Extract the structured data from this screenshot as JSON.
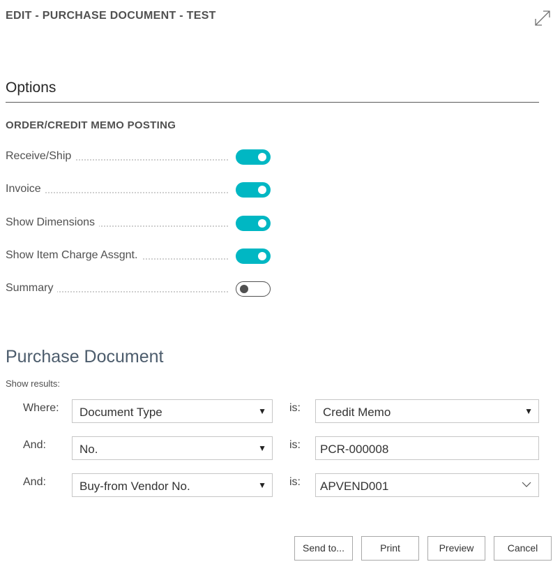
{
  "dialog": {
    "title": "EDIT - PURCHASE DOCUMENT - TEST"
  },
  "options": {
    "header": "Options",
    "group_caption": "ORDER/CREDIT MEMO POSTING",
    "items": [
      {
        "label": "Receive/Ship",
        "on": true
      },
      {
        "label": "Invoice",
        "on": true
      },
      {
        "label": "Show Dimensions",
        "on": true
      },
      {
        "label": "Show Item Charge Assgnt.",
        "on": true
      },
      {
        "label": "Summary",
        "on": false
      }
    ]
  },
  "purchase_document": {
    "header": "Purchase Document",
    "show_results": "Show results:",
    "is_label": "is:",
    "filters": [
      {
        "label": "Where:",
        "field": "Document Type",
        "value": "Credit Memo",
        "value_kind": "select"
      },
      {
        "label": "And:",
        "field": "No.",
        "value": "PCR-000008",
        "value_kind": "text"
      },
      {
        "label": "And:",
        "field": "Buy-from Vendor No.",
        "value": "APVEND001",
        "value_kind": "lookup"
      }
    ]
  },
  "buttons": {
    "send_to": "Send to...",
    "print": "Print",
    "preview": "Preview",
    "cancel": "Cancel"
  },
  "colors": {
    "toggle_on": "#00b7c3",
    "text": "#505050",
    "header_blue": "#4c5c6c"
  },
  "icons": {
    "expand": "expand-diagonal-icon",
    "dropdown": "triangle-down-icon",
    "lookup": "chevron-down-icon"
  }
}
